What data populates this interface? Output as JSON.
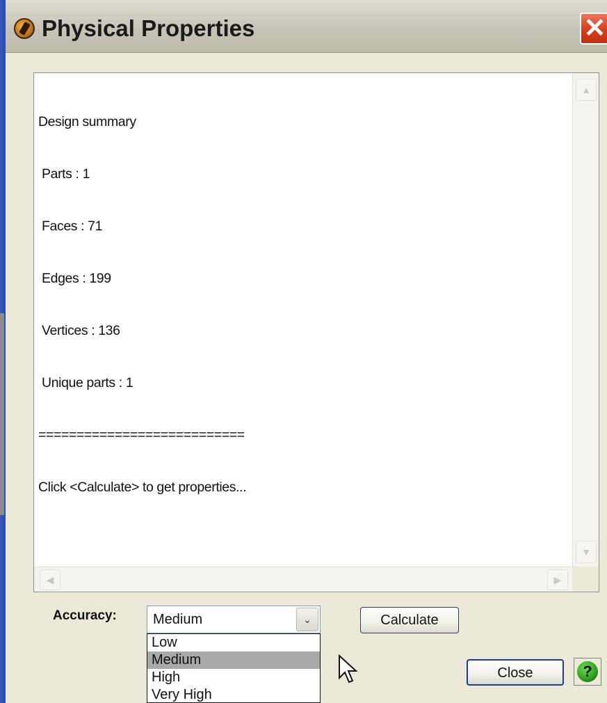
{
  "window": {
    "title": "Physical Properties",
    "close_glyph": "✕"
  },
  "summary": {
    "lines": [
      "Design summary",
      " Parts : 1",
      " Faces : 71",
      " Edges : 199",
      " Vertices : 136",
      " Unique parts : 1",
      "===========================",
      "Click <Calculate> to get properties..."
    ]
  },
  "scrollbars": {
    "up": "▲",
    "down": "▼",
    "left": "◀",
    "right": "▶"
  },
  "accuracy": {
    "label": "Accuracy:",
    "selected": "Medium",
    "arrow": "⌄",
    "options": [
      "Low",
      "Medium",
      "High",
      "Very High"
    ],
    "highlighted_index": 1
  },
  "buttons": {
    "calculate": "Calculate",
    "close": "Close",
    "help": "?"
  },
  "icons": {
    "app": "app-logo-icon",
    "help": "help-icon",
    "cursor": "mouse-pointer-icon"
  }
}
